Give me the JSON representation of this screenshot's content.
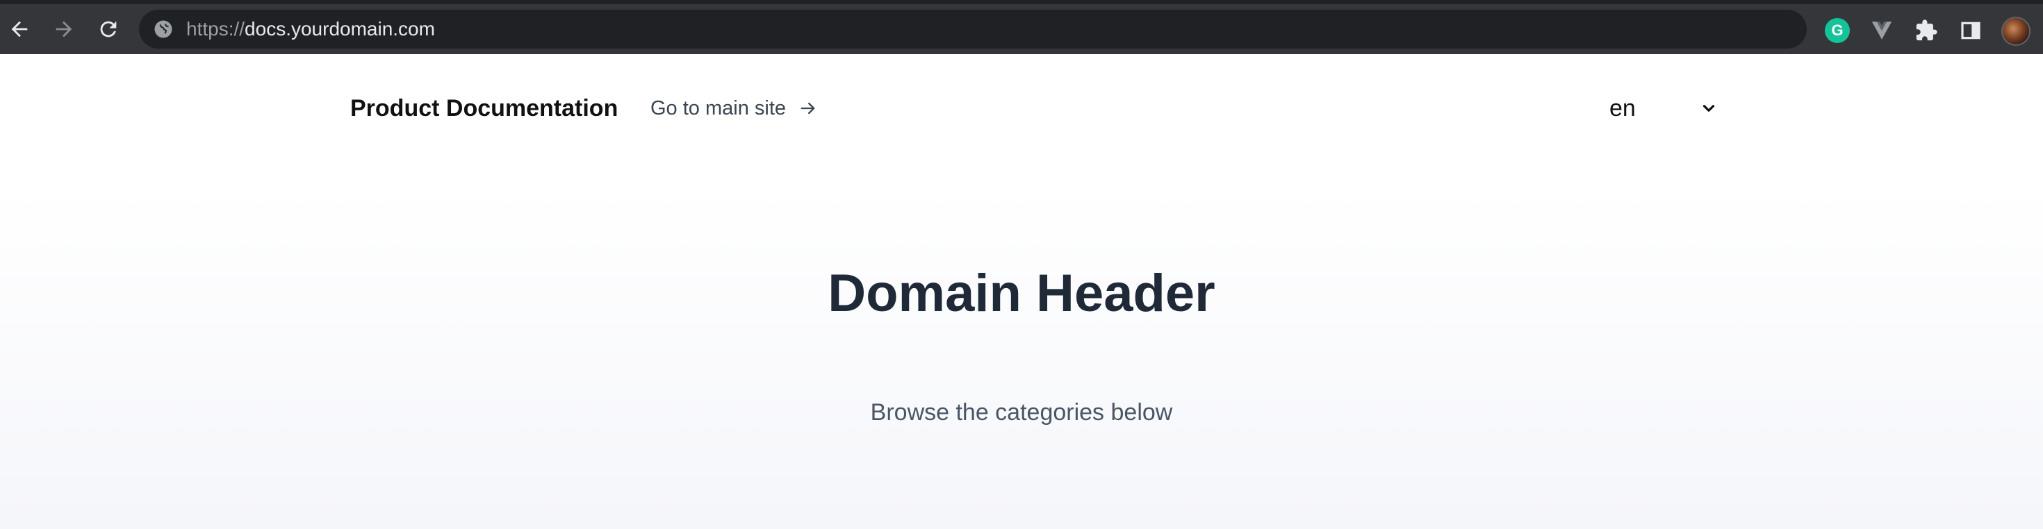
{
  "browser": {
    "url_scheme": "https://",
    "url_host": "docs.yourdomain.com",
    "extension_grammarly_letter": "G",
    "icons": [
      "back-arrow-icon",
      "forward-arrow-icon",
      "reload-icon",
      "site-info-icon",
      "grammarly-icon",
      "vue-devtools-icon",
      "extensions-puzzle-icon",
      "side-panel-icon",
      "profile-avatar"
    ]
  },
  "header": {
    "site_title": "Product Documentation",
    "main_site_link": "Go to main site",
    "language": {
      "selected": "en"
    }
  },
  "hero": {
    "title": "Domain Header",
    "subtitle": "Browse the categories below"
  },
  "colors": {
    "browser_bar": "#35363a",
    "url_bar": "#202124",
    "grammarly": "#15c39a",
    "heading": "#1f2937",
    "subtle_text": "#4b5563"
  }
}
